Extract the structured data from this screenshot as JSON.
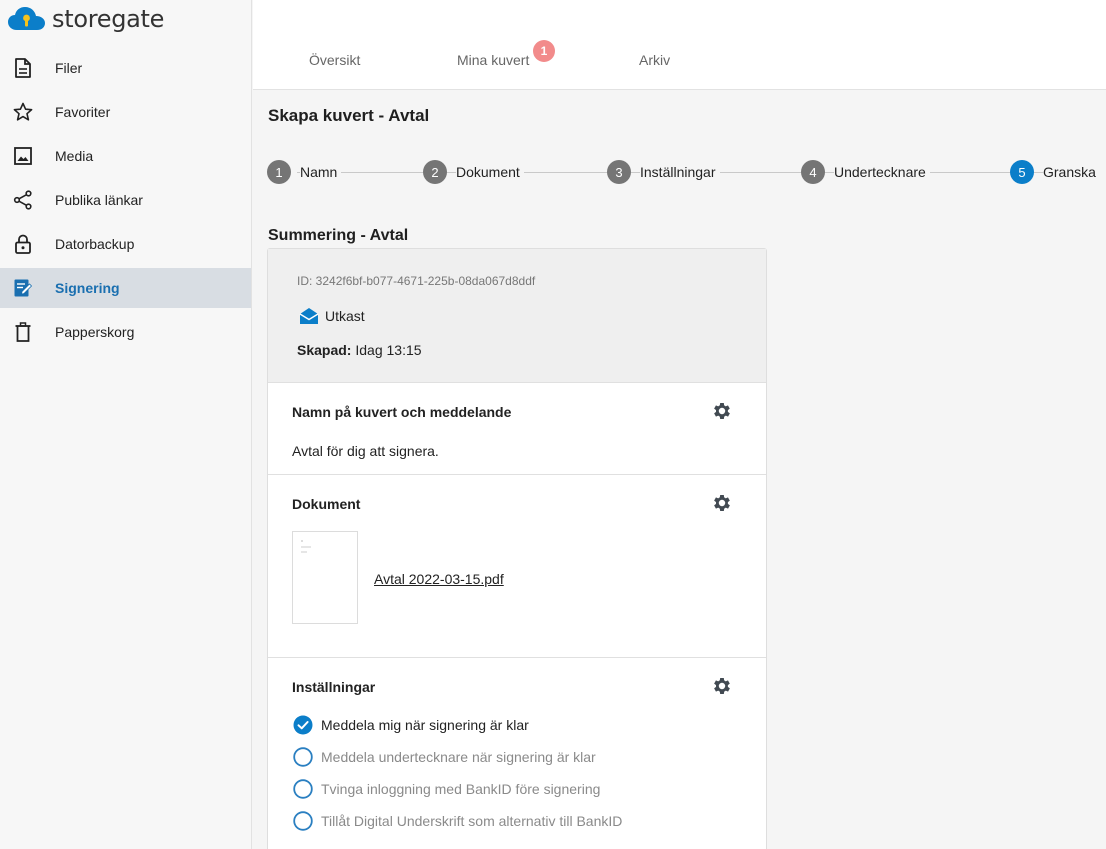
{
  "brand": {
    "name": "storegate",
    "accent": "#0b7ec9"
  },
  "sidebar": {
    "items": [
      {
        "label": "Filer",
        "icon": "file-icon",
        "active": false
      },
      {
        "label": "Favoriter",
        "icon": "star-icon",
        "active": false
      },
      {
        "label": "Media",
        "icon": "image-icon",
        "active": false
      },
      {
        "label": "Publika länkar",
        "icon": "share-icon",
        "active": false
      },
      {
        "label": "Datorbackup",
        "icon": "lock-icon",
        "active": false
      },
      {
        "label": "Signering",
        "icon": "signing-icon",
        "active": true
      },
      {
        "label": "Papperskorg",
        "icon": "trash-icon",
        "active": false
      }
    ]
  },
  "tabs": {
    "items": [
      {
        "label": "Översikt"
      },
      {
        "label": "Mina kuvert",
        "badge": "1"
      },
      {
        "label": "Arkiv"
      }
    ]
  },
  "page": {
    "title": "Skapa kuvert - Avtal"
  },
  "stepper": {
    "steps": [
      {
        "number": "1",
        "label": "Namn"
      },
      {
        "number": "2",
        "label": "Dokument"
      },
      {
        "number": "3",
        "label": "Inställningar"
      },
      {
        "number": "4",
        "label": "Undertecknare"
      },
      {
        "number": "5",
        "label": "Granska",
        "active": true
      }
    ]
  },
  "summary": {
    "title": "Summering - Avtal",
    "id_text": "ID: 3242f6bf-b077-4671-225b-08da067d8ddf",
    "status": "Utkast",
    "created_label": "Skapad:",
    "created_value": "Idag 13:15"
  },
  "sections": {
    "name": {
      "title": "Namn på kuvert och meddelande",
      "text": "Avtal för dig att signera."
    },
    "documents": {
      "title": "Dokument",
      "file": "Avtal 2022-03-15.pdf"
    },
    "settings": {
      "title": "Inställningar",
      "options": [
        {
          "label": "Meddela mig när signering är klar",
          "checked": true
        },
        {
          "label": "Meddela undertecknare när signering är klar",
          "checked": false
        },
        {
          "label": "Tvinga inloggning med BankID före signering",
          "checked": false
        },
        {
          "label": "Tillåt Digital Underskrift som alternativ till BankID",
          "checked": false
        }
      ]
    }
  }
}
